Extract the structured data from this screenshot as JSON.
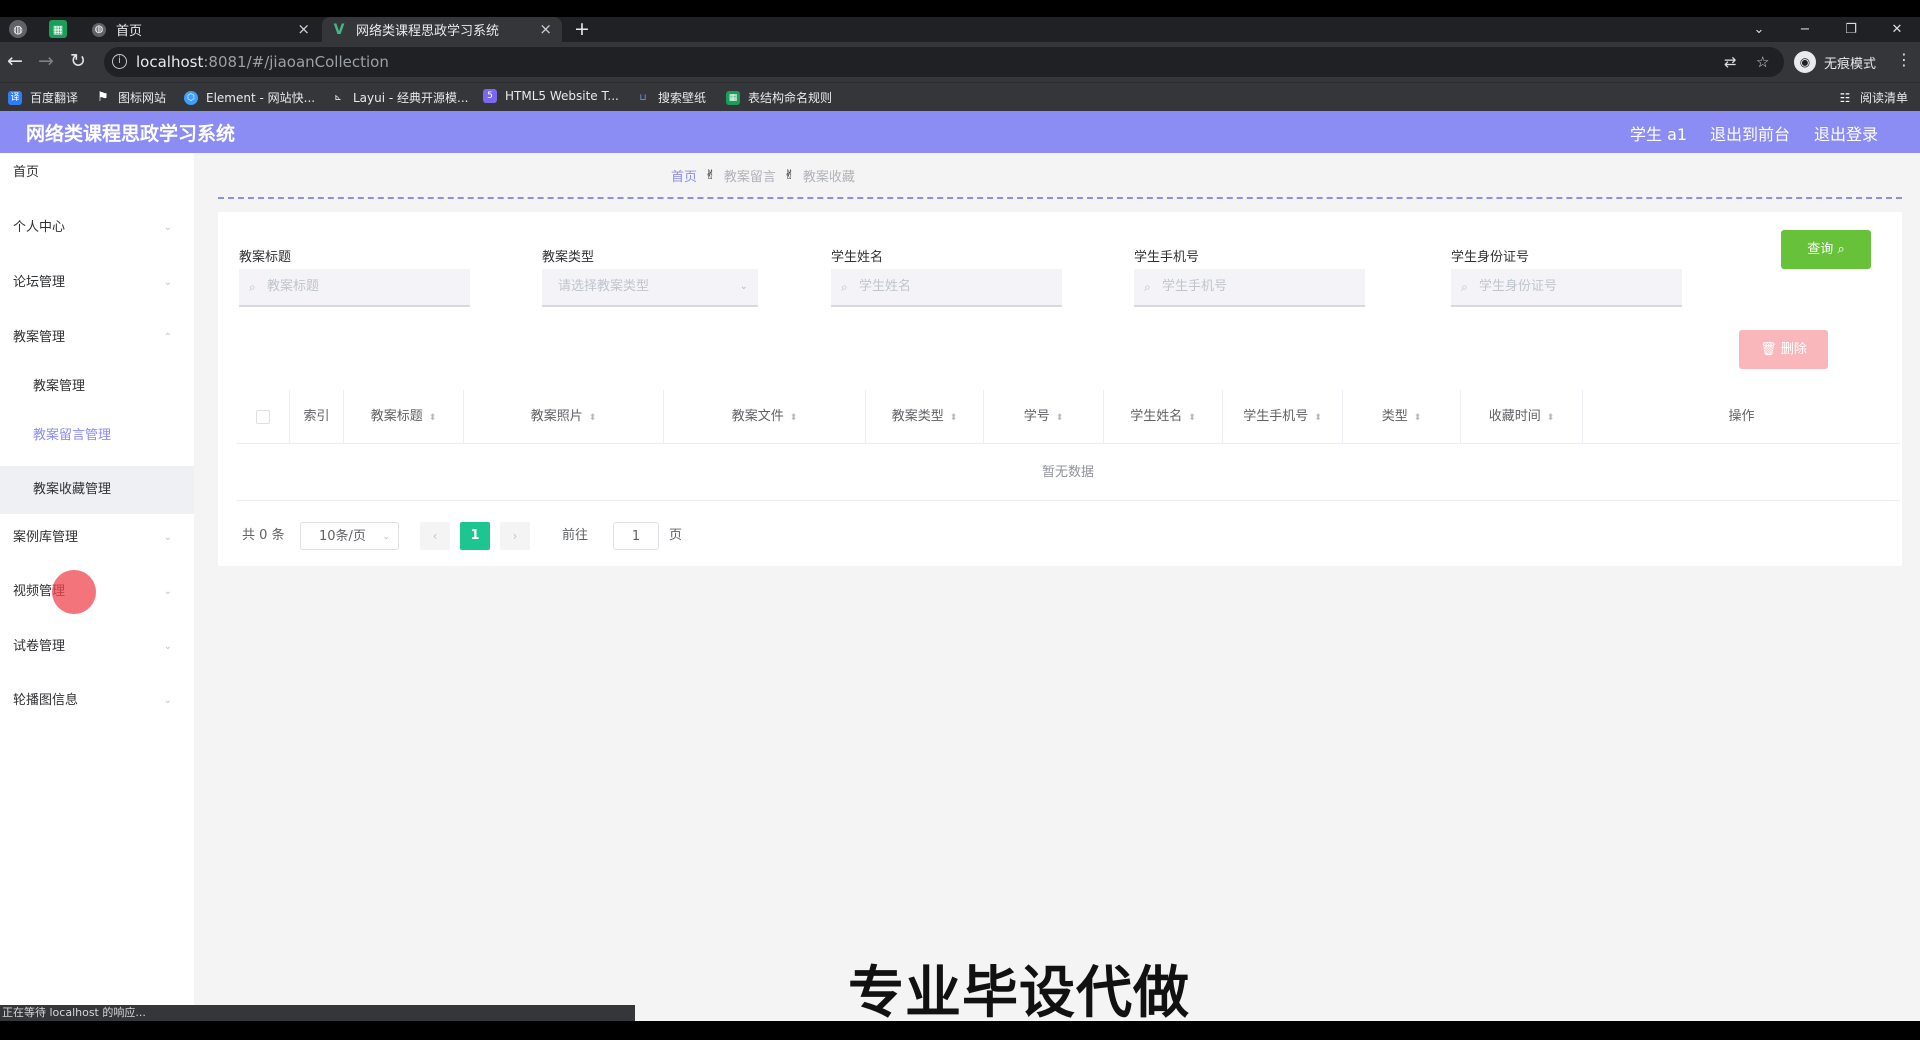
{
  "browser": {
    "tabs": [
      {
        "title": "首页",
        "active": false
      },
      {
        "title": "网络类课程思政学习系统",
        "active": true
      }
    ],
    "new_tab": "+",
    "address": {
      "host": "localhost",
      "rest": ":8081/#/jiaoanCollection"
    },
    "incognito_label": "无痕模式",
    "bookmarks": [
      "百度翻译",
      "图标网站",
      "Element - 网站快...",
      "Layui - 经典开源模...",
      "HTML5 Website T...",
      "搜索壁纸",
      "表结构命名规则"
    ],
    "reading_list": "阅读清单",
    "status_text": "正在等待 localhost 的响应..."
  },
  "header": {
    "title": "网络类课程思政学习系统",
    "user": "学生 a1",
    "to_front": "退出到前台",
    "logout": "退出登录"
  },
  "sidebar": {
    "items": [
      {
        "label": "首页"
      },
      {
        "label": "个人中心"
      },
      {
        "label": "论坛管理"
      },
      {
        "label": "教案管理"
      },
      {
        "label": "教案管理"
      },
      {
        "label": "教案留言管理"
      },
      {
        "label": "教案收藏管理"
      },
      {
        "label": "案例库管理"
      },
      {
        "label": "视频管理"
      },
      {
        "label": "试卷管理"
      },
      {
        "label": "轮播图信息"
      }
    ]
  },
  "breadcrumb": [
    "首页",
    "教案留言",
    "教案收藏"
  ],
  "filters": [
    {
      "label": "教案标题",
      "placeholder": "教案标题"
    },
    {
      "label": "教案类型",
      "placeholder": "请选择教案类型"
    },
    {
      "label": "学生姓名",
      "placeholder": "学生姓名"
    },
    {
      "label": "学生手机号",
      "placeholder": "学生手机号"
    },
    {
      "label": "学生身份证号",
      "placeholder": "学生身份证号"
    }
  ],
  "buttons": {
    "search": "查询",
    "delete": "删除"
  },
  "table": {
    "columns": [
      "索引",
      "教案标题",
      "教案照片",
      "教案文件",
      "教案类型",
      "学号",
      "学生姓名",
      "学生手机号",
      "类型",
      "收藏时间",
      "操作"
    ],
    "empty_text": "暂无数据"
  },
  "pagination": {
    "total": "共 0 条",
    "page_size": "10条/页",
    "current_page": "1",
    "goto_prefix": "前往",
    "goto_value": "1",
    "goto_suffix": "页"
  },
  "overlay_caption": "专业毕设代做",
  "colors": {
    "accent": "#8c8cf5",
    "search": "#67c23a",
    "delete": "#f9b7bb",
    "current_page": "#1ec68f"
  }
}
